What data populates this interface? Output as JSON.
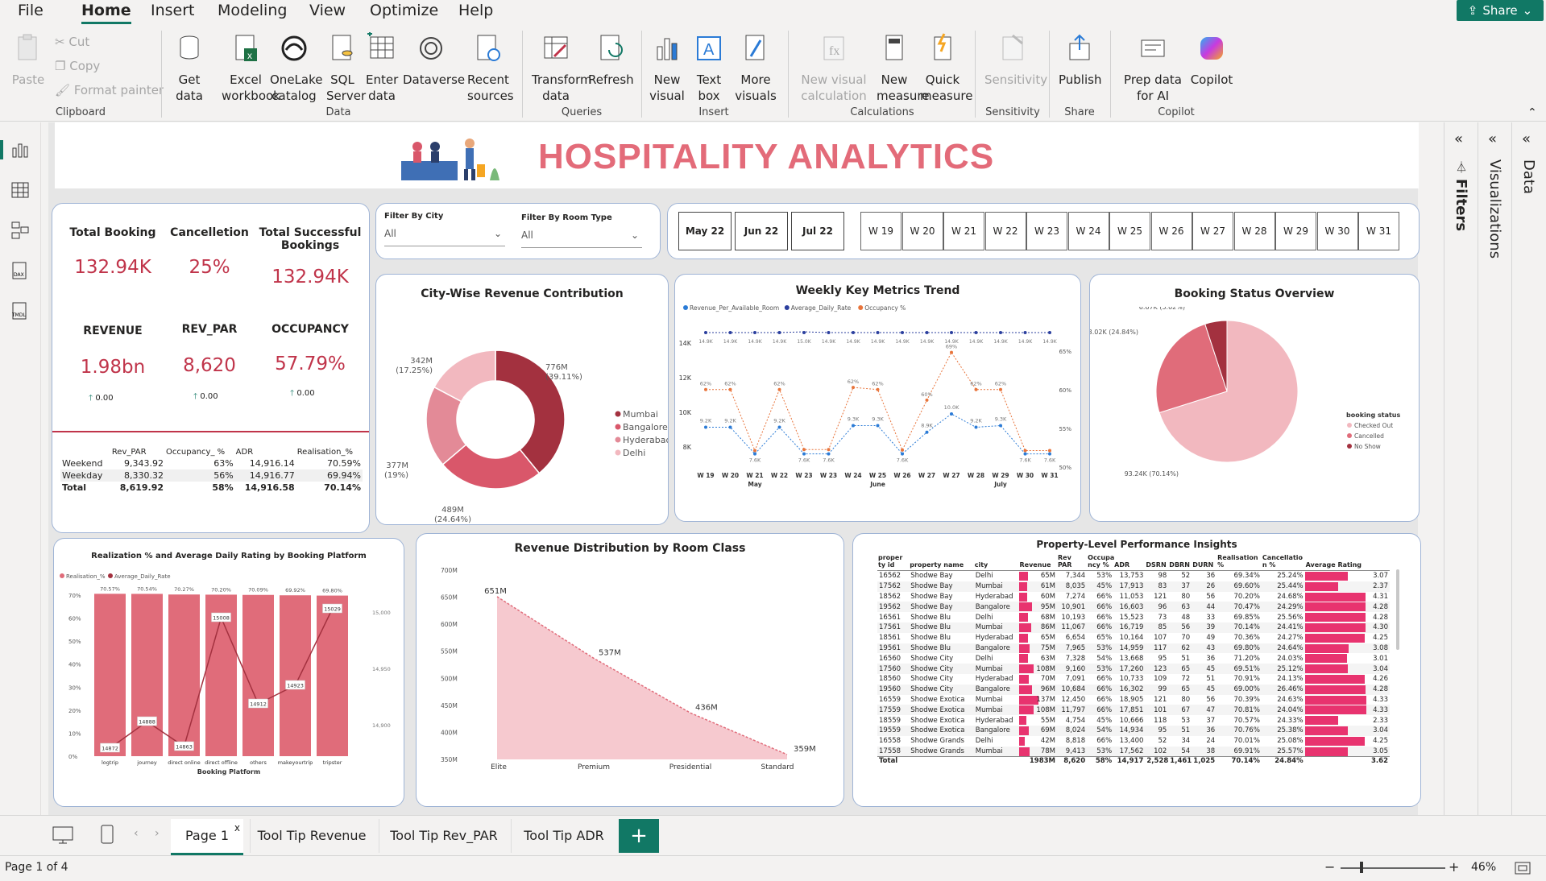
{
  "menu": {
    "items": [
      "File",
      "Home",
      "Insert",
      "Modeling",
      "View",
      "Optimize",
      "Help"
    ],
    "share": "Share"
  },
  "ribbon": {
    "clipboard": {
      "paste": "Paste",
      "cut": "Cut",
      "copy": "Copy",
      "format_painter": "Format painter",
      "group": "Clipboard"
    },
    "data": {
      "get_data": "Get data",
      "excel": "Excel workbook",
      "onelake": "OneLake catalog",
      "sql": "SQL Server",
      "enter": "Enter data",
      "dataverse": "Dataverse",
      "recent": "Recent sources",
      "group": "Data"
    },
    "queries": {
      "transform": "Transform data",
      "refresh": "Refresh",
      "group": "Queries"
    },
    "insert": {
      "new_visual": "New visual",
      "text_box": "Text box",
      "more_visuals": "More visuals",
      "group": "Insert"
    },
    "calculations": {
      "new_visual_calc": "New visual calculation",
      "new_measure": "New measure",
      "quick_measure": "Quick measure",
      "group": "Calculations"
    },
    "sensitivity": {
      "label": "Sensitivity",
      "group": "Sensitivity"
    },
    "share": {
      "publish": "Publish",
      "group": "Share"
    },
    "copilot": {
      "prep": "Prep data for AI",
      "copilot": "Copilot",
      "group": "Copilot"
    }
  },
  "header": {
    "title": "HOSPITALITY ANALYTICS"
  },
  "kpis": {
    "total_booking": {
      "label": "Total Booking",
      "value": "132.94K"
    },
    "cancellation": {
      "label": "Cancelletion",
      "value": "25%"
    },
    "successful": {
      "label": "Total Successful Bookings",
      "value": "132.94K"
    },
    "revenue": {
      "label": "REVENUE",
      "value": "1.98bn",
      "delta": "0.00"
    },
    "rev_par": {
      "label": "REV_PAR",
      "value": "8,620",
      "delta": "0.00"
    },
    "occupancy": {
      "label": "OCCUPANCY",
      "value": "57.79%",
      "delta": "0.00"
    }
  },
  "daytype_table": {
    "headers": [
      "",
      "Rev_PAR",
      "Occupancy_ %",
      "ADR",
      "Realisation_%"
    ],
    "rows": [
      [
        "Weekend",
        "9,343.92",
        "63%",
        "14,916.14",
        "70.59%"
      ],
      [
        "Weekday",
        "8,330.32",
        "56%",
        "14,916.77",
        "69.94%"
      ]
    ],
    "total": [
      "Total",
      "8,619.92",
      "58%",
      "14,916.58",
      "70.14%"
    ]
  },
  "filters": {
    "city_label": "Filter By City",
    "city_value": "All",
    "room_label": "Filter By Room Type",
    "room_value": "All"
  },
  "months": [
    "May 22",
    "Jun 22",
    "Jul 22"
  ],
  "weeks": [
    "W 19",
    "W 20",
    "W 21",
    "W 22",
    "W 23",
    "W 24",
    "W 25",
    "W 26",
    "W 27",
    "W 28",
    "W 29",
    "W 30",
    "W 31"
  ],
  "city_chart": {
    "title": "City-Wise Revenue Contribution",
    "slices": [
      {
        "label": "776M (39.11%)",
        "city": "Mumbai",
        "value": 776,
        "color": "#a3313f"
      },
      {
        "label": "489M (24.64%)",
        "city": "Bangalore",
        "value": 489,
        "color": "#d9576a"
      },
      {
        "label": "377M (19%)",
        "city": "Hyderabad",
        "value": 377,
        "color": "#e38a97"
      },
      {
        "label": "342M (17.25%)",
        "city": "Delhi",
        "value": 342,
        "color": "#f2b8bf"
      }
    ]
  },
  "trend_chart": {
    "title": "Weekly Key Metrics Trend",
    "legend": [
      "Revenue_Per_Available_Room",
      "Average_Daily_Rate",
      "Occupancy %"
    ],
    "weeks": [
      "W 19",
      "W 20",
      "W 21",
      "W 22",
      "W 23",
      "W 23",
      "W 24",
      "W 25",
      "W 26",
      "W 27",
      "W 27",
      "W 28",
      "W 29",
      "W 30",
      "W 31"
    ],
    "months": [
      "May",
      "June",
      "July"
    ],
    "y_left": [
      "14K",
      "12K",
      "10K",
      "8K"
    ],
    "y_right": [
      "65%",
      "60%",
      "55%",
      "50%"
    ],
    "adr_labels": [
      "14.9K",
      "14.9K",
      "14.9K",
      "14.9K",
      "15.0K",
      "14.9K",
      "14.9K",
      "14.9K",
      "14.9K",
      "14.9K",
      "14.9K",
      "14.9K",
      "14.9K",
      "14.9K",
      "14.9K"
    ],
    "revpar_labels": [
      "9.2K",
      "9.2K",
      "7.6K",
      "9.2K",
      "7.6K",
      "7.6K",
      "9.3K",
      "9.3K",
      "7.6K",
      "8.9K",
      "10.0K",
      "9.2K",
      "9.3K",
      "7.6K",
      "7.6K"
    ],
    "occ_labels": [
      "62%",
      "62%",
      "",
      "62%",
      "",
      "",
      "62%",
      "62%",
      "",
      "60%",
      "69%",
      "62%",
      "62%",
      "",
      ""
    ]
  },
  "status_chart": {
    "title": "Booking Status Overview",
    "legend_title": "booking status",
    "slices": [
      {
        "label": "93.24K (70.14%)",
        "name": "Checked Out",
        "value": 93.24,
        "color": "#f2b8bf"
      },
      {
        "label": "33.02K (24.84%)",
        "name": "Cancelled",
        "value": 33.02,
        "color": "#e06c7a"
      },
      {
        "label": "6.67K (5.02%)",
        "name": "No Show",
        "value": 6.67,
        "color": "#a3313f"
      }
    ]
  },
  "platform_chart": {
    "title": "Realization % and Average Daily Rating by Booking Platform",
    "legend": [
      "Realisation_%",
      "Average_Daily_Rate"
    ],
    "xlabel": "Booking Platform",
    "categories": [
      "logtrip",
      "journey",
      "direct online",
      "direct offline",
      "others",
      "makeyourtrip",
      "tripster"
    ],
    "realisation": [
      "70.57%",
      "70.54%",
      "70.27%",
      "70.20%",
      "70.09%",
      "69.92%",
      "69.80%"
    ],
    "adr": [
      "14872",
      "14888",
      "14863",
      "15008",
      "14912",
      "14923",
      "15029"
    ],
    "y_left": [
      "70%",
      "60%",
      "50%",
      "40%",
      "30%",
      "20%",
      "10%",
      "0%"
    ],
    "y_right": [
      "15,000",
      "14,950",
      "14,900"
    ]
  },
  "room_chart": {
    "title": "Revenue Distribution by Room Class",
    "categories": [
      "Elite",
      "Premium",
      "Presidential",
      "Standard"
    ],
    "values": [
      651,
      537,
      436,
      359
    ],
    "labels": [
      "651M",
      "537M",
      "436M",
      "359M"
    ],
    "y_ticks": [
      "700M",
      "650M",
      "600M",
      "550M",
      "500M",
      "450M",
      "400M",
      "350M"
    ]
  },
  "property_table": {
    "title": "Property-Level Performance Insights",
    "headers": [
      "proper ty id",
      "property name",
      "city",
      "Revenue",
      "Rev PAR",
      "Occupa ncy %",
      "ADR",
      "DSRN",
      "DBRN",
      "DURN",
      "Realisation %",
      "Cancellatio n %",
      "Average Rating"
    ],
    "rows": [
      [
        "16562",
        "Shodwe Bay",
        "Delhi",
        "65M",
        "7,344",
        "53%",
        "13,753",
        "98",
        "52",
        "36",
        "69.34%",
        "25.24%",
        "3.07"
      ],
      [
        "17562",
        "Shodwe Bay",
        "Mumbai",
        "61M",
        "8,035",
        "45%",
        "17,913",
        "83",
        "37",
        "26",
        "69.60%",
        "25.44%",
        "2.37"
      ],
      [
        "18562",
        "Shodwe Bay",
        "Hyderabad",
        "60M",
        "7,274",
        "66%",
        "11,053",
        "121",
        "80",
        "56",
        "70.20%",
        "24.68%",
        "4.31"
      ],
      [
        "19562",
        "Shodwe Bay",
        "Bangalore",
        "95M",
        "10,901",
        "66%",
        "16,603",
        "96",
        "63",
        "44",
        "70.47%",
        "24.29%",
        "4.28"
      ],
      [
        "16561",
        "Shodwe Blu",
        "Delhi",
        "68M",
        "10,193",
        "66%",
        "15,523",
        "73",
        "48",
        "33",
        "69.85%",
        "25.56%",
        "4.28"
      ],
      [
        "17561",
        "Shodwe Blu",
        "Mumbai",
        "86M",
        "11,067",
        "66%",
        "16,719",
        "85",
        "56",
        "39",
        "70.14%",
        "24.41%",
        "4.30"
      ],
      [
        "18561",
        "Shodwe Blu",
        "Hyderabad",
        "65M",
        "6,654",
        "65%",
        "10,164",
        "107",
        "70",
        "49",
        "70.36%",
        "24.27%",
        "4.25"
      ],
      [
        "19561",
        "Shodwe Blu",
        "Bangalore",
        "75M",
        "7,965",
        "53%",
        "14,959",
        "117",
        "62",
        "43",
        "69.80%",
        "24.64%",
        "3.08"
      ],
      [
        "16560",
        "Shodwe City",
        "Delhi",
        "63M",
        "7,328",
        "54%",
        "13,668",
        "95",
        "51",
        "36",
        "71.20%",
        "24.03%",
        "3.01"
      ],
      [
        "17560",
        "Shodwe City",
        "Mumbai",
        "108M",
        "9,160",
        "53%",
        "17,260",
        "123",
        "65",
        "45",
        "69.51%",
        "25.12%",
        "3.04"
      ],
      [
        "18560",
        "Shodwe City",
        "Hyderabad",
        "70M",
        "7,091",
        "66%",
        "10,733",
        "109",
        "72",
        "51",
        "70.91%",
        "24.13%",
        "4.26"
      ],
      [
        "19560",
        "Shodwe City",
        "Bangalore",
        "96M",
        "10,684",
        "66%",
        "16,302",
        "99",
        "65",
        "45",
        "69.00%",
        "26.46%",
        "4.28"
      ],
      [
        "16559",
        "Shodwe Exotica",
        "Mumbai",
        "137M",
        "12,450",
        "66%",
        "18,905",
        "121",
        "80",
        "56",
        "70.39%",
        "24.63%",
        "4.33"
      ],
      [
        "17559",
        "Shodwe Exotica",
        "Mumbai",
        "108M",
        "11,797",
        "66%",
        "17,851",
        "101",
        "67",
        "47",
        "70.81%",
        "24.04%",
        "4.33"
      ],
      [
        "18559",
        "Shodwe Exotica",
        "Hyderabad",
        "55M",
        "4,754",
        "45%",
        "10,666",
        "118",
        "53",
        "37",
        "70.57%",
        "24.33%",
        "2.33"
      ],
      [
        "19559",
        "Shodwe Exotica",
        "Bangalore",
        "69M",
        "8,024",
        "54%",
        "14,934",
        "95",
        "51",
        "36",
        "70.76%",
        "25.38%",
        "3.04"
      ],
      [
        "16558",
        "Shodwe Grands",
        "Delhi",
        "42M",
        "8,818",
        "66%",
        "13,400",
        "52",
        "34",
        "24",
        "70.01%",
        "25.08%",
        "4.25"
      ],
      [
        "17558",
        "Shodwe Grands",
        "Mumbai",
        "78M",
        "9,413",
        "53%",
        "17,562",
        "102",
        "54",
        "38",
        "69.91%",
        "25.57%",
        "3.05"
      ]
    ],
    "revenue_values": [
      65,
      61,
      60,
      95,
      68,
      86,
      65,
      75,
      63,
      108,
      70,
      96,
      137,
      108,
      55,
      69,
      42,
      78
    ],
    "rating_values": [
      3.07,
      2.37,
      4.31,
      4.28,
      4.28,
      4.3,
      4.25,
      3.08,
      3.01,
      3.04,
      4.26,
      4.28,
      4.33,
      4.33,
      2.33,
      3.04,
      4.25,
      3.05
    ],
    "total": [
      "Total",
      "",
      "",
      "1983M",
      "8,620",
      "58%",
      "14,917",
      "2,528",
      "1,461",
      "1,025",
      "70.14%",
      "24.84%",
      "3.62"
    ]
  },
  "panes": {
    "filters": "Filters",
    "visualizations": "Visualizations",
    "data": "Data"
  },
  "tabs": [
    "Page 1",
    "Tool Tip Revenue",
    "Tool Tip Rev_PAR",
    "Tool Tip ADR"
  ],
  "status": {
    "page": "Page 1 of 4",
    "zoom": "46%"
  }
}
